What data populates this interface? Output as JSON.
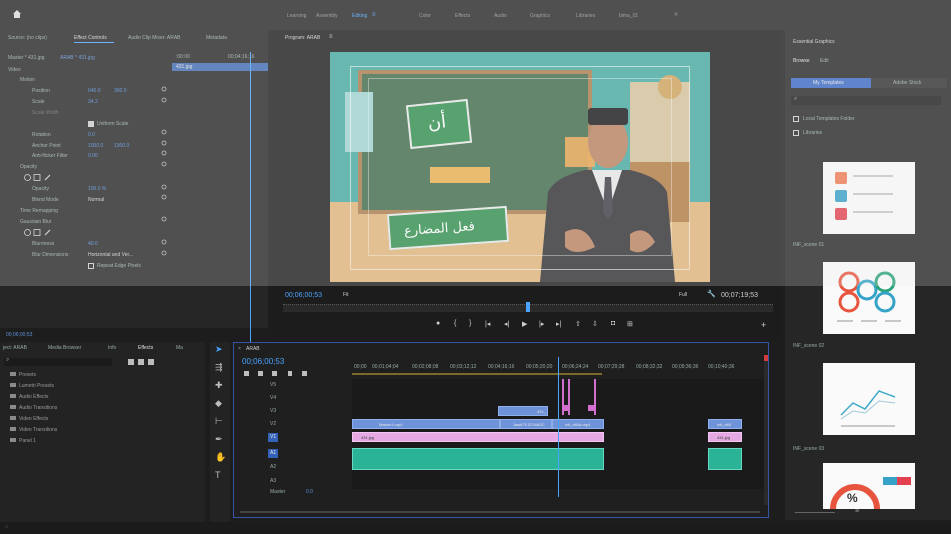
{
  "topbar": {
    "home_icon": "home-icon",
    "workspaces": [
      "Learning",
      "Assembly",
      "Editing",
      "Color",
      "Effects",
      "Audio",
      "Graphics",
      "Libraries",
      "bima_01"
    ],
    "active_workspace": "Editing",
    "more": "»"
  },
  "effect_controls": {
    "tabs": [
      "Source: (no clips)",
      "Effect Controls",
      "Audio Clip Mixer: ARAB",
      "Metadata"
    ],
    "master": "Master * 431.jpg",
    "sequence": "ARAB * 431.jpg",
    "time_start": ":00:00",
    "time_end": "00;04;16;16",
    "clip_label": "431.jpg",
    "video_label": "Video",
    "motion": "Motion",
    "position": {
      "label": "Position",
      "x": "640.0",
      "y": "360.0"
    },
    "scale": {
      "label": "Scale",
      "value": "34.2"
    },
    "scale_width": "Scale Width",
    "uniform_scale": "Uniform Scale",
    "rotation": {
      "label": "Rotation",
      "value": "0.0"
    },
    "anchor": {
      "label": "Anchor Point",
      "x": "1000.0",
      "y": "1300.0"
    },
    "antiflicker": {
      "label": "Anti-flicker Filter",
      "value": "0.00"
    },
    "opacity_section": "Opacity",
    "opacity": {
      "label": "Opacity",
      "value": "100.0 %"
    },
    "blend": {
      "label": "Blend Mode",
      "value": "Normal"
    },
    "time_remap": "Time Remapping",
    "blur_section": "Gaussian Blur",
    "blurriness": {
      "label": "Blurriness",
      "value": "40.0"
    },
    "blur_dim": {
      "label": "Blur Dimensions",
      "value": "Horizontal and Ver..."
    },
    "repeat_edge": "Repeat Edge Pixels",
    "current_time": "00;06;00;53"
  },
  "program": {
    "tab": "Program: ARAB",
    "timecode": "00;06;00;53",
    "fit": "Fit",
    "full": "Full",
    "duration": "00;07;19;53",
    "arabic_top": "أن",
    "arabic_bottom": "فعل المضارع"
  },
  "projects": {
    "tabs": [
      "ject: ARAB",
      "Media Browser",
      "Info",
      "Effects",
      "Ma"
    ],
    "active_tab": "Effects",
    "items": [
      "Presets",
      "Lumetri Presets",
      "Audio Effects",
      "Audio Transitions",
      "Video Effects",
      "Video Transitions",
      "Panel 1"
    ]
  },
  "timeline": {
    "tab": "ARAB",
    "timecode": "00;06;00;53",
    "ruler": [
      "00;00",
      "00;01;04;04",
      "00;02;08;08",
      "00;03;12;12",
      "00;04;16;16",
      "00;05;20;20",
      "00;06;24;24",
      "00;07;29;28",
      "00;08;32;32",
      "00;09;36;36",
      "00;10;40;36"
    ],
    "video_tracks": [
      "V5",
      "V4",
      "V3",
      "V2",
      "V1"
    ],
    "audio_tracks": [
      "A1",
      "A2",
      "A3"
    ],
    "master": "Master",
    "master_val": "0.0",
    "clips": {
      "v3": "431_",
      "v2a": "Master1.mp4",
      "v2b": "Jaw675 DTMASC",
      "v2c": "Intl_a65a.mp4",
      "v2d": "Intl_a65",
      "v1a": "431.jpg",
      "v1b": "431.jpg"
    }
  },
  "essential_graphics": {
    "title": "Essential Graphics",
    "tabs": [
      "Browse",
      "Edit"
    ],
    "my_templates": "My Templates",
    "adobe_stock": "Adobe Stock",
    "local_folder": "Local Templates Folder",
    "libraries": "Libraries",
    "items": [
      "INF_scene 01",
      "INF_scene 02",
      "INF_scene 03"
    ],
    "stat": "%"
  },
  "statusbar": "00;06;00;53"
}
